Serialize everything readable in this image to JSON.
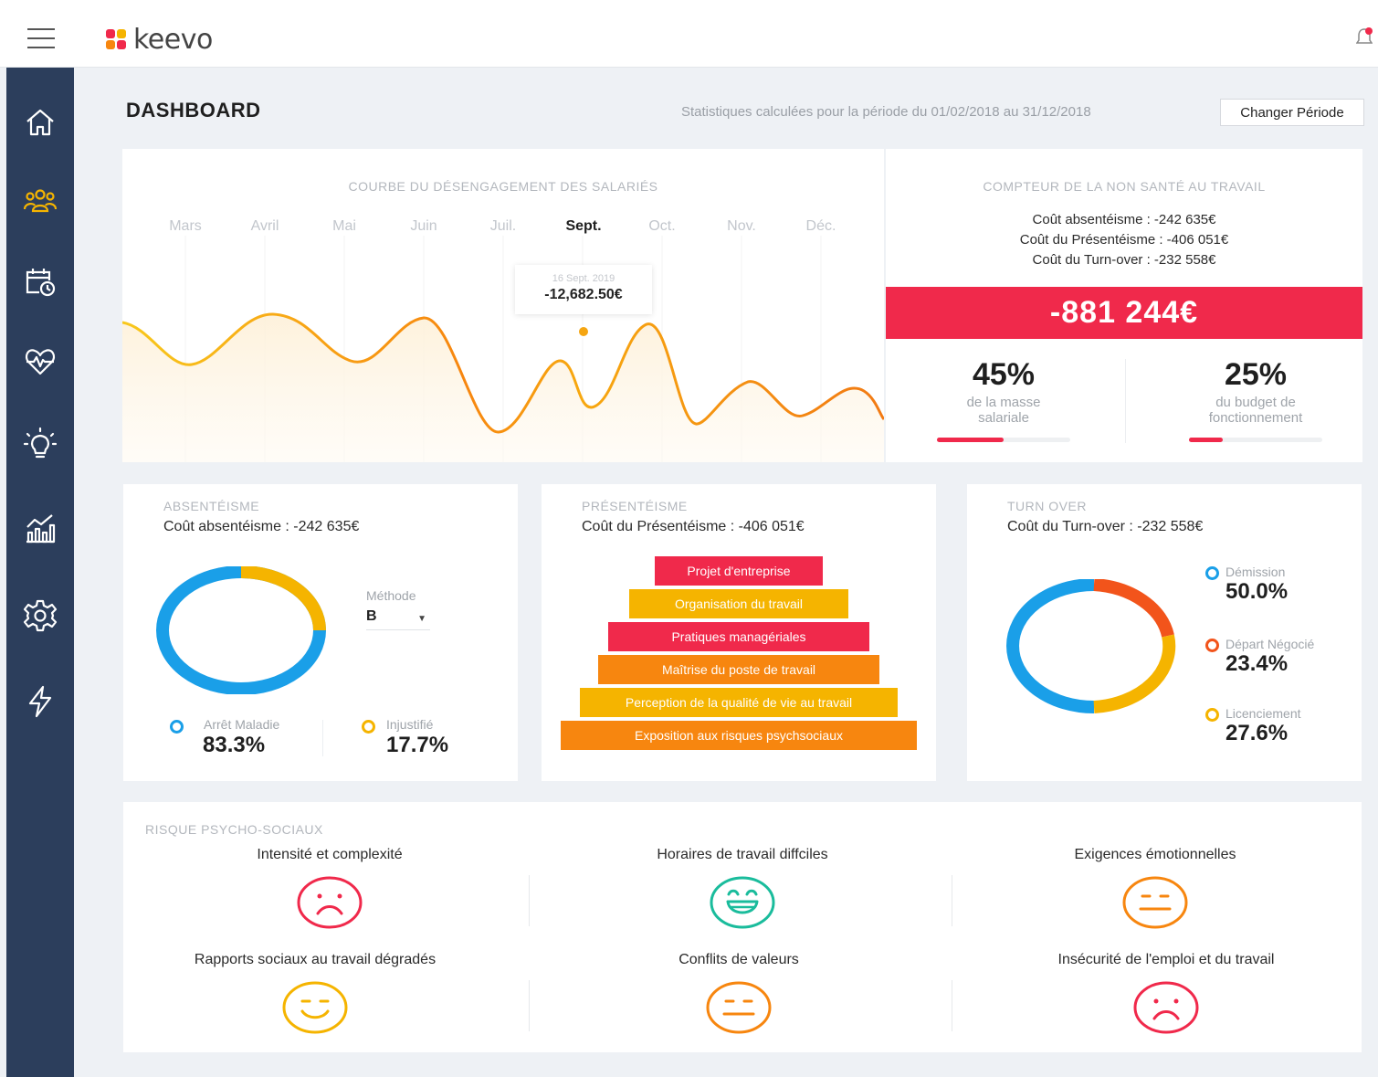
{
  "app": {
    "logo_text": "keevo"
  },
  "icons": {
    "menu": "hamburger-icon",
    "notification": "bell-icon",
    "nav": [
      "home-icon",
      "users-icon",
      "calendar-clock-icon",
      "heart-pulse-icon",
      "lightbulb-icon",
      "analytics-chart-icon",
      "gear-icon",
      "lightning-icon"
    ]
  },
  "colors": {
    "sidebar": "#2c3e5c",
    "active_nav": "#f5b400",
    "accent_red": "#f0294b",
    "orange": "#f7860f",
    "yellow": "#f5b400",
    "blue": "#1a9fe8",
    "teal": "#1abc9c"
  },
  "header": {
    "title": "DASHBOARD",
    "period_text": "Statistiques calculées pour la période du 01/02/2018 au 31/12/2018",
    "period_button": "Changer Période"
  },
  "disengagement": {
    "title": "COURBE DU DÉSENGAGEMENT DES SALARIÉS",
    "months": [
      "Mars",
      "Avril",
      "Mai",
      "Juin",
      "Juil.",
      "Sept.",
      "Oct.",
      "Nov.",
      "Déc."
    ],
    "active_month": "Sept.",
    "tooltip_date": "16 Sept. 2019",
    "tooltip_value": "-12,682.50€"
  },
  "counter": {
    "title": "COMPTEUR DE LA NON SANTÉ AU TRAVAIL",
    "lines": [
      "Coût absentéisme : -242 635€",
      "Coût du Présentéisme : -406 051€",
      "Coût du Turn-over : -232 558€"
    ],
    "total": "-881 244€",
    "payroll_pct": "45%",
    "payroll_label": "de la masse salariale",
    "payroll_fraction": 0.5,
    "budget_pct": "25%",
    "budget_label": "du budget de fonctionnement",
    "budget_fraction": 0.25
  },
  "absenteeism": {
    "title": "ABSENTÉISME",
    "subtitle": "Coût absentéisme : -242 635€",
    "method_label": "Méthode",
    "method_value": "B",
    "legend": [
      {
        "label": "Arrêt Maladie",
        "value": "83.3%"
      },
      {
        "label": "Injustifié",
        "value": "17.7%"
      }
    ],
    "donut": [
      83.3,
      16.7
    ]
  },
  "presenteeism": {
    "title": "PRÉSENTÉISME",
    "subtitle": "Coût du Présentéisme : -406 051€",
    "pyramid": [
      "Projet d'entreprise",
      "Organisation du travail",
      "Pratiques managériales",
      "Maîtrise du poste de travail",
      "Perception de la qualité de vie au travail",
      "Exposition aux risques psychsociaux"
    ]
  },
  "turnover": {
    "title": "TURN OVER",
    "subtitle": "Coût du Turn-over : -232 558€",
    "legend": [
      {
        "label": "Démission",
        "value": "50.0%"
      },
      {
        "label": "Départ Négocié",
        "value": "23.4%"
      },
      {
        "label": "Licenciement",
        "value": "27.6%"
      }
    ],
    "donut": [
      50.0,
      23.4,
      27.6
    ]
  },
  "risks": {
    "title": "RISQUE PSYCHO-SOCIAUX",
    "items": [
      {
        "label": "Intensité et complexité",
        "mood": "sad-face-icon"
      },
      {
        "label": "Horaires de travail diffciles",
        "mood": "happy-face-icon"
      },
      {
        "label": "Exigences émotionnelles",
        "mood": "neutral-face-icon"
      },
      {
        "label": "Rapports sociaux au travail dégradés",
        "mood": "smile-face-icon"
      },
      {
        "label": "Conflits de valeurs",
        "mood": "neutral-face-icon"
      },
      {
        "label": "Insécurité de l'emploi et du travail",
        "mood": "sad-face-icon"
      }
    ]
  }
}
